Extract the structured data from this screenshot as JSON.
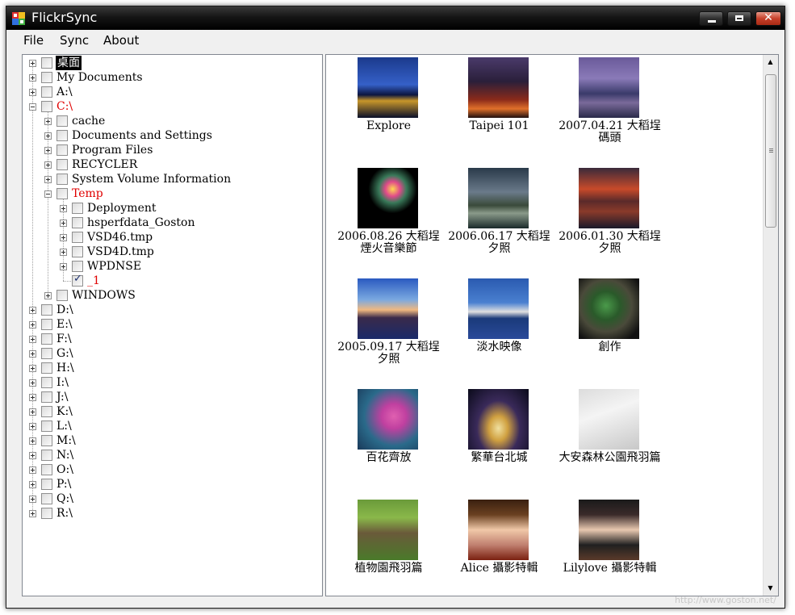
{
  "window": {
    "title": "FlickrSync",
    "close_glyph": "✕"
  },
  "menu": [
    {
      "label": "File"
    },
    {
      "label": "Sync"
    },
    {
      "label": "About"
    }
  ],
  "tree": [
    {
      "label": "桌面",
      "indent": 0,
      "expander": "plus",
      "selected": true
    },
    {
      "label": "My Documents",
      "indent": 0,
      "expander": "plus"
    },
    {
      "label": "A:\\",
      "indent": 0,
      "expander": "plus"
    },
    {
      "label": "C:\\",
      "indent": 0,
      "expander": "minus",
      "red": true
    },
    {
      "label": "cache",
      "indent": 1,
      "expander": "plus"
    },
    {
      "label": "Documents and Settings",
      "indent": 1,
      "expander": "plus"
    },
    {
      "label": "Program Files",
      "indent": 1,
      "expander": "plus"
    },
    {
      "label": "RECYCLER",
      "indent": 1,
      "expander": "plus"
    },
    {
      "label": "System Volume Information",
      "indent": 1,
      "expander": "plus"
    },
    {
      "label": "Temp",
      "indent": 1,
      "expander": "minus",
      "red": true
    },
    {
      "label": "Deployment",
      "indent": 2,
      "expander": "plus"
    },
    {
      "label": "hsperfdata_Goston",
      "indent": 2,
      "expander": "plus"
    },
    {
      "label": "VSD46.tmp",
      "indent": 2,
      "expander": "plus"
    },
    {
      "label": "VSD4D.tmp",
      "indent": 2,
      "expander": "plus"
    },
    {
      "label": "WPDNSE",
      "indent": 2,
      "expander": "plus"
    },
    {
      "label": "_1",
      "indent": 2,
      "expander": "none",
      "red": true,
      "checked": true
    },
    {
      "label": "WINDOWS",
      "indent": 1,
      "expander": "plus"
    },
    {
      "label": "D:\\",
      "indent": 0,
      "expander": "plus"
    },
    {
      "label": "E:\\",
      "indent": 0,
      "expander": "plus"
    },
    {
      "label": "F:\\",
      "indent": 0,
      "expander": "plus"
    },
    {
      "label": "G:\\",
      "indent": 0,
      "expander": "plus"
    },
    {
      "label": "H:\\",
      "indent": 0,
      "expander": "plus"
    },
    {
      "label": "I:\\",
      "indent": 0,
      "expander": "plus"
    },
    {
      "label": "J:\\",
      "indent": 0,
      "expander": "plus"
    },
    {
      "label": "K:\\",
      "indent": 0,
      "expander": "plus"
    },
    {
      "label": "L:\\",
      "indent": 0,
      "expander": "plus"
    },
    {
      "label": "M:\\",
      "indent": 0,
      "expander": "plus"
    },
    {
      "label": "N:\\",
      "indent": 0,
      "expander": "plus"
    },
    {
      "label": "O:\\",
      "indent": 0,
      "expander": "plus"
    },
    {
      "label": "P:\\",
      "indent": 0,
      "expander": "plus"
    },
    {
      "label": "Q:\\",
      "indent": 0,
      "expander": "plus"
    },
    {
      "label": "R:\\",
      "indent": 0,
      "expander": "plus"
    }
  ],
  "photos": [
    {
      "caption": "Explore",
      "bg": "linear-gradient(180deg,#1b3a8c 0%,#3560c8 45%,#0c1540 62%,#c8962a 72%,#0a0f2a 100%)"
    },
    {
      "caption": "Taipei 101",
      "bg": "linear-gradient(180deg,#4a3a6a 0%,#2a1f3a 40%,#8a2a1a 70%,#e0702a 85%,#201010 100%)"
    },
    {
      "caption": "2007.04.21 大稻埕碼頭",
      "bg": "linear-gradient(180deg,#6a5a9a 0%,#8a7ab8 35%,#3a3a6a 60%,#7a6a9a 75%,#2a2a4a 100%)"
    },
    {
      "caption": "2006.08.26 大稻埕煙火音樂節",
      "bg": "radial-gradient(circle at 58% 35%,#ffd850 0%,#e04a8a 14%,#3a7a5a 26%,#000 46%)"
    },
    {
      "caption": "2006.06.17 大稻埕夕照",
      "bg": "linear-gradient(180deg,#2a3a4a 0%,#6a7a8a 40%,#3a4a3a 62%,#8a9a8a 75%,#1a2a2a 100%)"
    },
    {
      "caption": "2006.01.30 大稻埕夕照",
      "bg": "linear-gradient(180deg,#3a2a3a 0%,#c84a2a 35%,#5a2a2a 55%,#8a3a2a 72%,#1a1a2a 100%)"
    },
    {
      "caption": "2005.09.17 大稻埕夕照",
      "bg": "linear-gradient(180deg,#2a5ac0 0%,#7aa8e0 35%,#f0b880 52%,#3a2a4a 65%,#1a2a6a 100%)"
    },
    {
      "caption": "淡水映像",
      "bg": "linear-gradient(180deg,#2a5ab0 0%,#4a80d0 40%,#e0e0e0 55%,#1a3a7a 66%,#2a4a9a 100%)"
    },
    {
      "caption": "創作",
      "bg": "radial-gradient(circle at 45% 45%,#4a9a4a 0%,#2a5a2a 30%,#4a4a3a 55%,#111 85%)"
    },
    {
      "caption": "百花齊放",
      "bg": "radial-gradient(circle at 60% 45%,#e060b0 0%,#c040a0 25%,#2a6a8a 60%,#1a3a5a 100%)"
    },
    {
      "caption": "繁華台北城",
      "bg": "radial-gradient(ellipse at 50% 65%,#f0e0a0 0%,#d0a040 22%,#3a2a5a 50%,#0a0a1a 100%)"
    },
    {
      "caption": "大安森林公園飛羽篇",
      "bg": "linear-gradient(160deg,#dcdcdc 0%,#f4f4f4 40%,#c8c8c8 100%)"
    },
    {
      "caption": "植物園飛羽篇",
      "bg": "linear-gradient(180deg,#6a9a3a 0%,#8ab84a 30%,#6a5a3a 55%,#4a7a2a 100%)"
    },
    {
      "caption": "Alice 攝影特輯",
      "bg": "linear-gradient(180deg,#3a2010 0%,#6a4020 25%,#f0c8a8 50%,#c08070 75%,#7a2010 100%)"
    },
    {
      "caption": "Lilylove 攝影特輯",
      "bg": "linear-gradient(180deg,#1a1a1a 0%,#3a2a2a 25%,#e8c8b0 50%,#202020 75%,#5a3a2a 100%)"
    }
  ],
  "scrollbar": {
    "up": "▲",
    "down": "▼"
  },
  "watermark": "http://www.goston.net/"
}
